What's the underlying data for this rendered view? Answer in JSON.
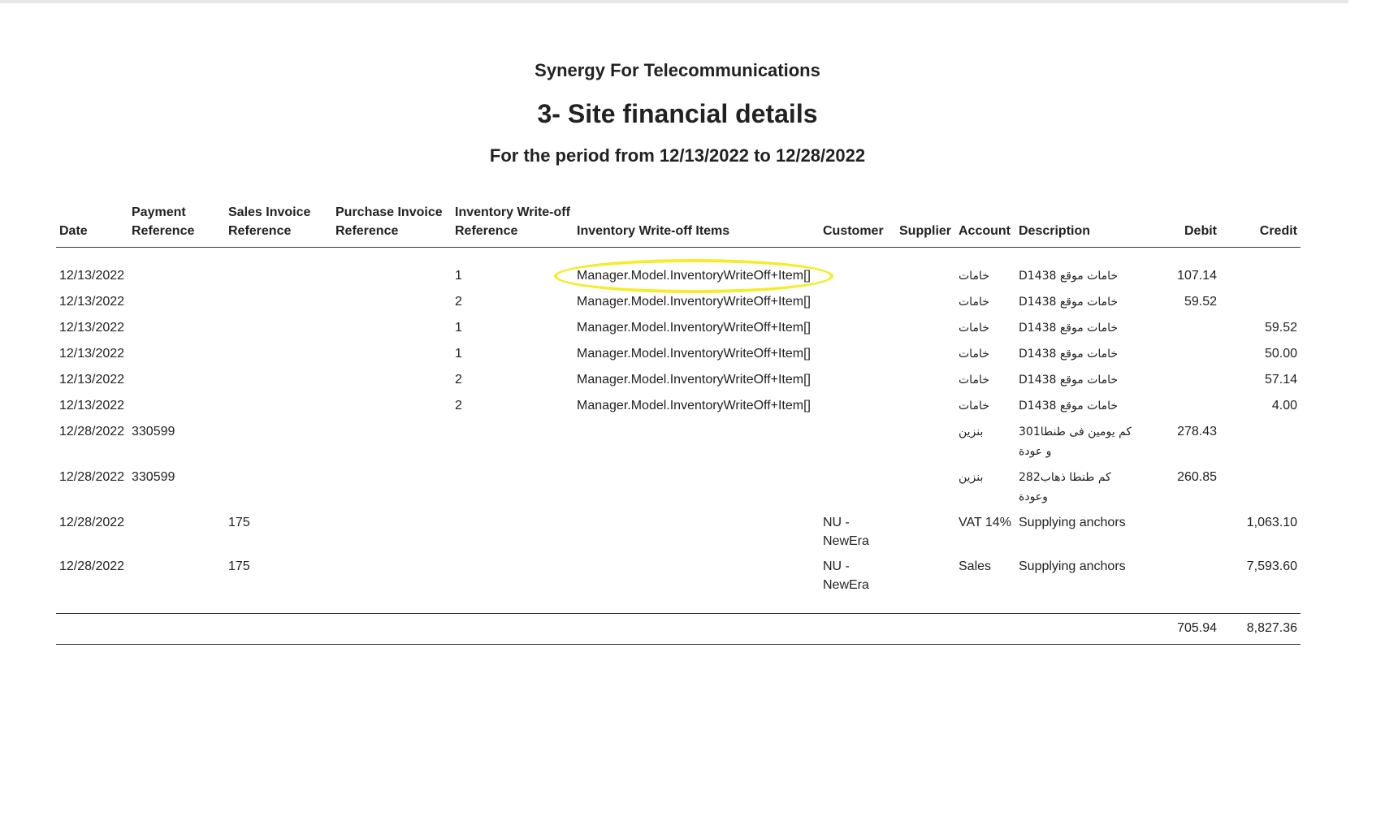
{
  "report": {
    "company": "Synergy For Telecommunications",
    "title": "3- Site financial details",
    "period": "For the period from 12/13/2022 to 12/28/2022"
  },
  "table": {
    "columns": {
      "date": "Date",
      "payment_reference": "Payment Reference",
      "sales_invoice_reference": "Sales Invoice Reference",
      "purchase_invoice_reference": "Purchase Invoice Reference",
      "inventory_writeoff_reference": "Inventory Write-off Reference",
      "inventory_writeoff_items": "Inventory Write-off Items",
      "customer": "Customer",
      "supplier": "Supplier",
      "account": "Account",
      "description": "Description",
      "debit": "Debit",
      "credit": "Credit"
    },
    "rows": [
      {
        "date": "12/13/2022",
        "payment_ref": "",
        "sales_ref": "",
        "purchase_ref": "",
        "writeoff_ref": "1",
        "writeoff_items": "Manager.Model.InventoryWriteOff+Item[]",
        "customer": "",
        "supplier": "",
        "account": "خامات",
        "description": "D1438 خامات موقع",
        "debit": "107.14",
        "credit": ""
      },
      {
        "date": "12/13/2022",
        "payment_ref": "",
        "sales_ref": "",
        "purchase_ref": "",
        "writeoff_ref": "2",
        "writeoff_items": "Manager.Model.InventoryWriteOff+Item[]",
        "customer": "",
        "supplier": "",
        "account": "خامات",
        "description": "D1438 خامات موقع",
        "debit": "59.52",
        "credit": ""
      },
      {
        "date": "12/13/2022",
        "payment_ref": "",
        "sales_ref": "",
        "purchase_ref": "",
        "writeoff_ref": "1",
        "writeoff_items": "Manager.Model.InventoryWriteOff+Item[]",
        "customer": "",
        "supplier": "",
        "account": "خامات",
        "description": "D1438 خامات موقع",
        "debit": "",
        "credit": "59.52"
      },
      {
        "date": "12/13/2022",
        "payment_ref": "",
        "sales_ref": "",
        "purchase_ref": "",
        "writeoff_ref": "1",
        "writeoff_items": "Manager.Model.InventoryWriteOff+Item[]",
        "customer": "",
        "supplier": "",
        "account": "خامات",
        "description": "D1438 خامات موقع",
        "debit": "",
        "credit": "50.00"
      },
      {
        "date": "12/13/2022",
        "payment_ref": "",
        "sales_ref": "",
        "purchase_ref": "",
        "writeoff_ref": "2",
        "writeoff_items": "Manager.Model.InventoryWriteOff+Item[]",
        "customer": "",
        "supplier": "",
        "account": "خامات",
        "description": "D1438 خامات موقع",
        "debit": "",
        "credit": "57.14"
      },
      {
        "date": "12/13/2022",
        "payment_ref": "",
        "sales_ref": "",
        "purchase_ref": "",
        "writeoff_ref": "2",
        "writeoff_items": "Manager.Model.InventoryWriteOff+Item[]",
        "customer": "",
        "supplier": "",
        "account": "خامات",
        "description": "D1438 خامات موقع",
        "debit": "",
        "credit": "4.00"
      },
      {
        "date": "12/28/2022",
        "payment_ref": "330599",
        "sales_ref": "",
        "purchase_ref": "",
        "writeoff_ref": "",
        "writeoff_items": "",
        "customer": "",
        "supplier": "",
        "account": "بنزين",
        "description": "301كم يومين فى طنطا و عودة",
        "debit": "278.43",
        "credit": ""
      },
      {
        "date": "12/28/2022",
        "payment_ref": "330599",
        "sales_ref": "",
        "purchase_ref": "",
        "writeoff_ref": "",
        "writeoff_items": "",
        "customer": "",
        "supplier": "",
        "account": "بنزين",
        "description": "282كم طنطا ذهاب وعودة",
        "debit": "260.85",
        "credit": ""
      },
      {
        "date": "12/28/2022",
        "payment_ref": "",
        "sales_ref": "175",
        "purchase_ref": "",
        "writeoff_ref": "",
        "writeoff_items": "",
        "customer": "NU - NewEra",
        "supplier": "",
        "account": "VAT 14%",
        "description": "Supplying anchors",
        "debit": "",
        "credit": "1,063.10"
      },
      {
        "date": "12/28/2022",
        "payment_ref": "",
        "sales_ref": "175",
        "purchase_ref": "",
        "writeoff_ref": "",
        "writeoff_items": "",
        "customer": "NU - NewEra",
        "supplier": "",
        "account": "Sales",
        "description": "Supplying anchors",
        "debit": "",
        "credit": "7,593.60"
      }
    ],
    "totals": {
      "debit": "705.94",
      "credit": "8,827.36"
    }
  },
  "annotation": {
    "highlight_color": "#f5ec2c",
    "highlighted_row_index": 0
  }
}
